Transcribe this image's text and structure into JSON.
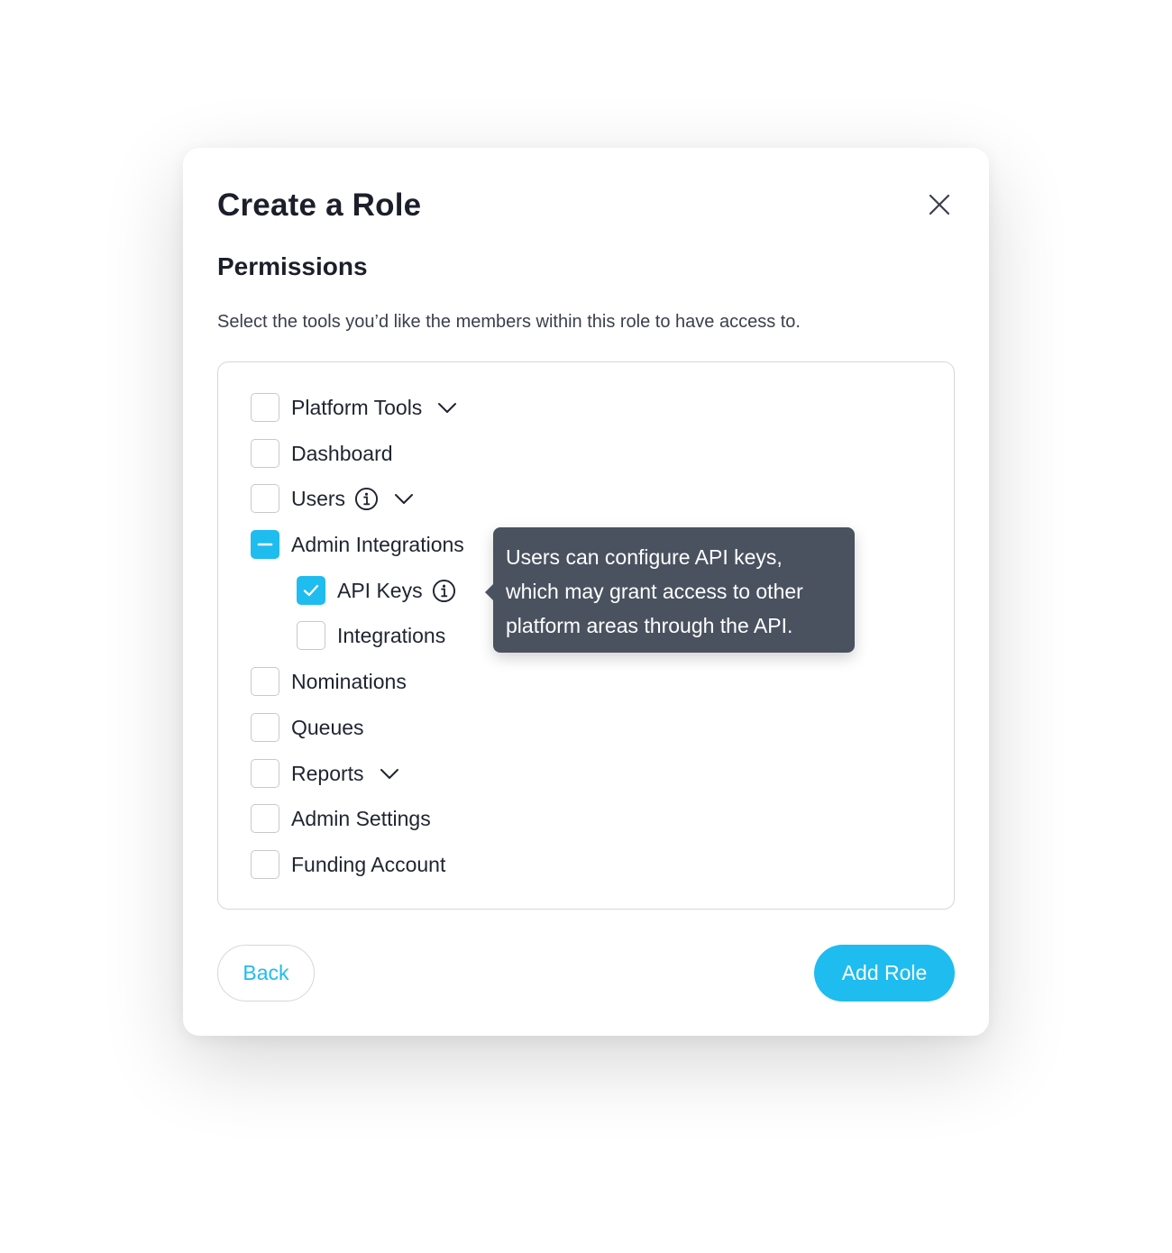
{
  "modal": {
    "title": "Create a Role",
    "section_title": "Permissions",
    "description": "Select the tools you’d like the members within this role to have access to."
  },
  "permissions": [
    {
      "label": "Platform Tools",
      "state": "unchecked",
      "expandable": true,
      "info": false
    },
    {
      "label": "Dashboard",
      "state": "unchecked",
      "expandable": false,
      "info": false
    },
    {
      "label": "Users",
      "state": "unchecked",
      "expandable": true,
      "info": true
    },
    {
      "label": "Admin Integrations",
      "state": "indeterminate",
      "expandable": false,
      "info": false,
      "children": [
        {
          "label": "API Keys",
          "state": "checked",
          "info": true
        },
        {
          "label": "Integrations",
          "state": "unchecked",
          "info": false
        }
      ]
    },
    {
      "label": "Nominations",
      "state": "unchecked",
      "expandable": false,
      "info": false
    },
    {
      "label": "Queues",
      "state": "unchecked",
      "expandable": false,
      "info": false
    },
    {
      "label": "Reports",
      "state": "unchecked",
      "expandable": true,
      "info": false
    },
    {
      "label": "Admin Settings",
      "state": "unchecked",
      "expandable": false,
      "info": false
    },
    {
      "label": "Funding Account",
      "state": "unchecked",
      "expandable": false,
      "info": false
    }
  ],
  "tooltip": {
    "lines": [
      "Users can configure API keys,",
      "which may grant access to other",
      "platform areas through the API."
    ]
  },
  "buttons": {
    "back": "Back",
    "add_role": "Add Role"
  },
  "icons": {
    "close": "close-icon",
    "chevron": "chevron-down-icon",
    "info": "info-icon",
    "check": "check-icon",
    "minus": "minus-icon"
  },
  "colors": {
    "accent": "#1fbcef",
    "tooltip_bg": "#4a5260",
    "border": "#d4d7dc"
  }
}
